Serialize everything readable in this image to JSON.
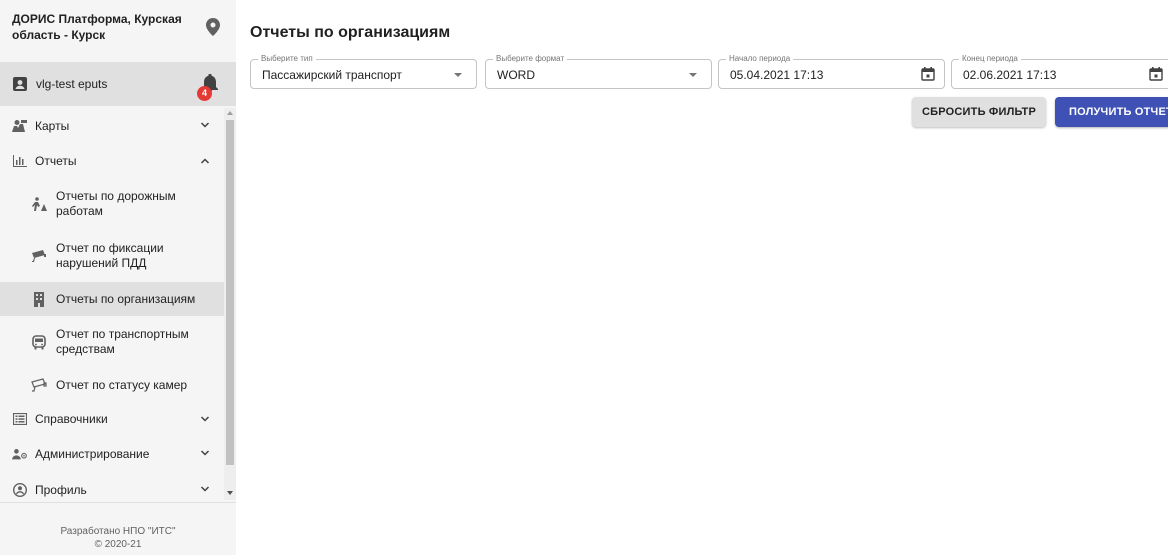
{
  "brand": {
    "title": "ДОРИС Платформа, Курская область - Курск"
  },
  "user": {
    "name": "vlg-test eputs",
    "notifications": "4"
  },
  "menu": {
    "maps": "Карты",
    "reports": "Отчеты",
    "reports_sub": [
      "Отчеты по дорожным работам",
      "Отчет по фиксации нарушений ПДД",
      "Отчеты по организациям",
      "Отчет по транспортным средствам",
      "Отчет по статусу камер"
    ],
    "directories": "Справочники",
    "admin": "Администрирование",
    "profile": "Профиль"
  },
  "footer": {
    "line1": "Разработано НПО \"ИТС\"",
    "line2": "© 2020-21"
  },
  "main": {
    "title": "Отчеты по организациям",
    "type_field": {
      "label": "Выберите тип",
      "value": "Пассажирский транспорт"
    },
    "format_field": {
      "label": "Выберите формат",
      "value": "WORD"
    },
    "start_field": {
      "label": "Начало периода",
      "value": "05.04.2021 17:13"
    },
    "end_field": {
      "label": "Конец периода",
      "value": "02.06.2021 17:13"
    },
    "reset_button": "СБРОСИТЬ ФИЛЬТР",
    "get_button": "ПОЛУЧИТЬ ОТЧЕТ"
  },
  "colors": {
    "primary": "#3f51b5",
    "badge": "#e53935"
  }
}
